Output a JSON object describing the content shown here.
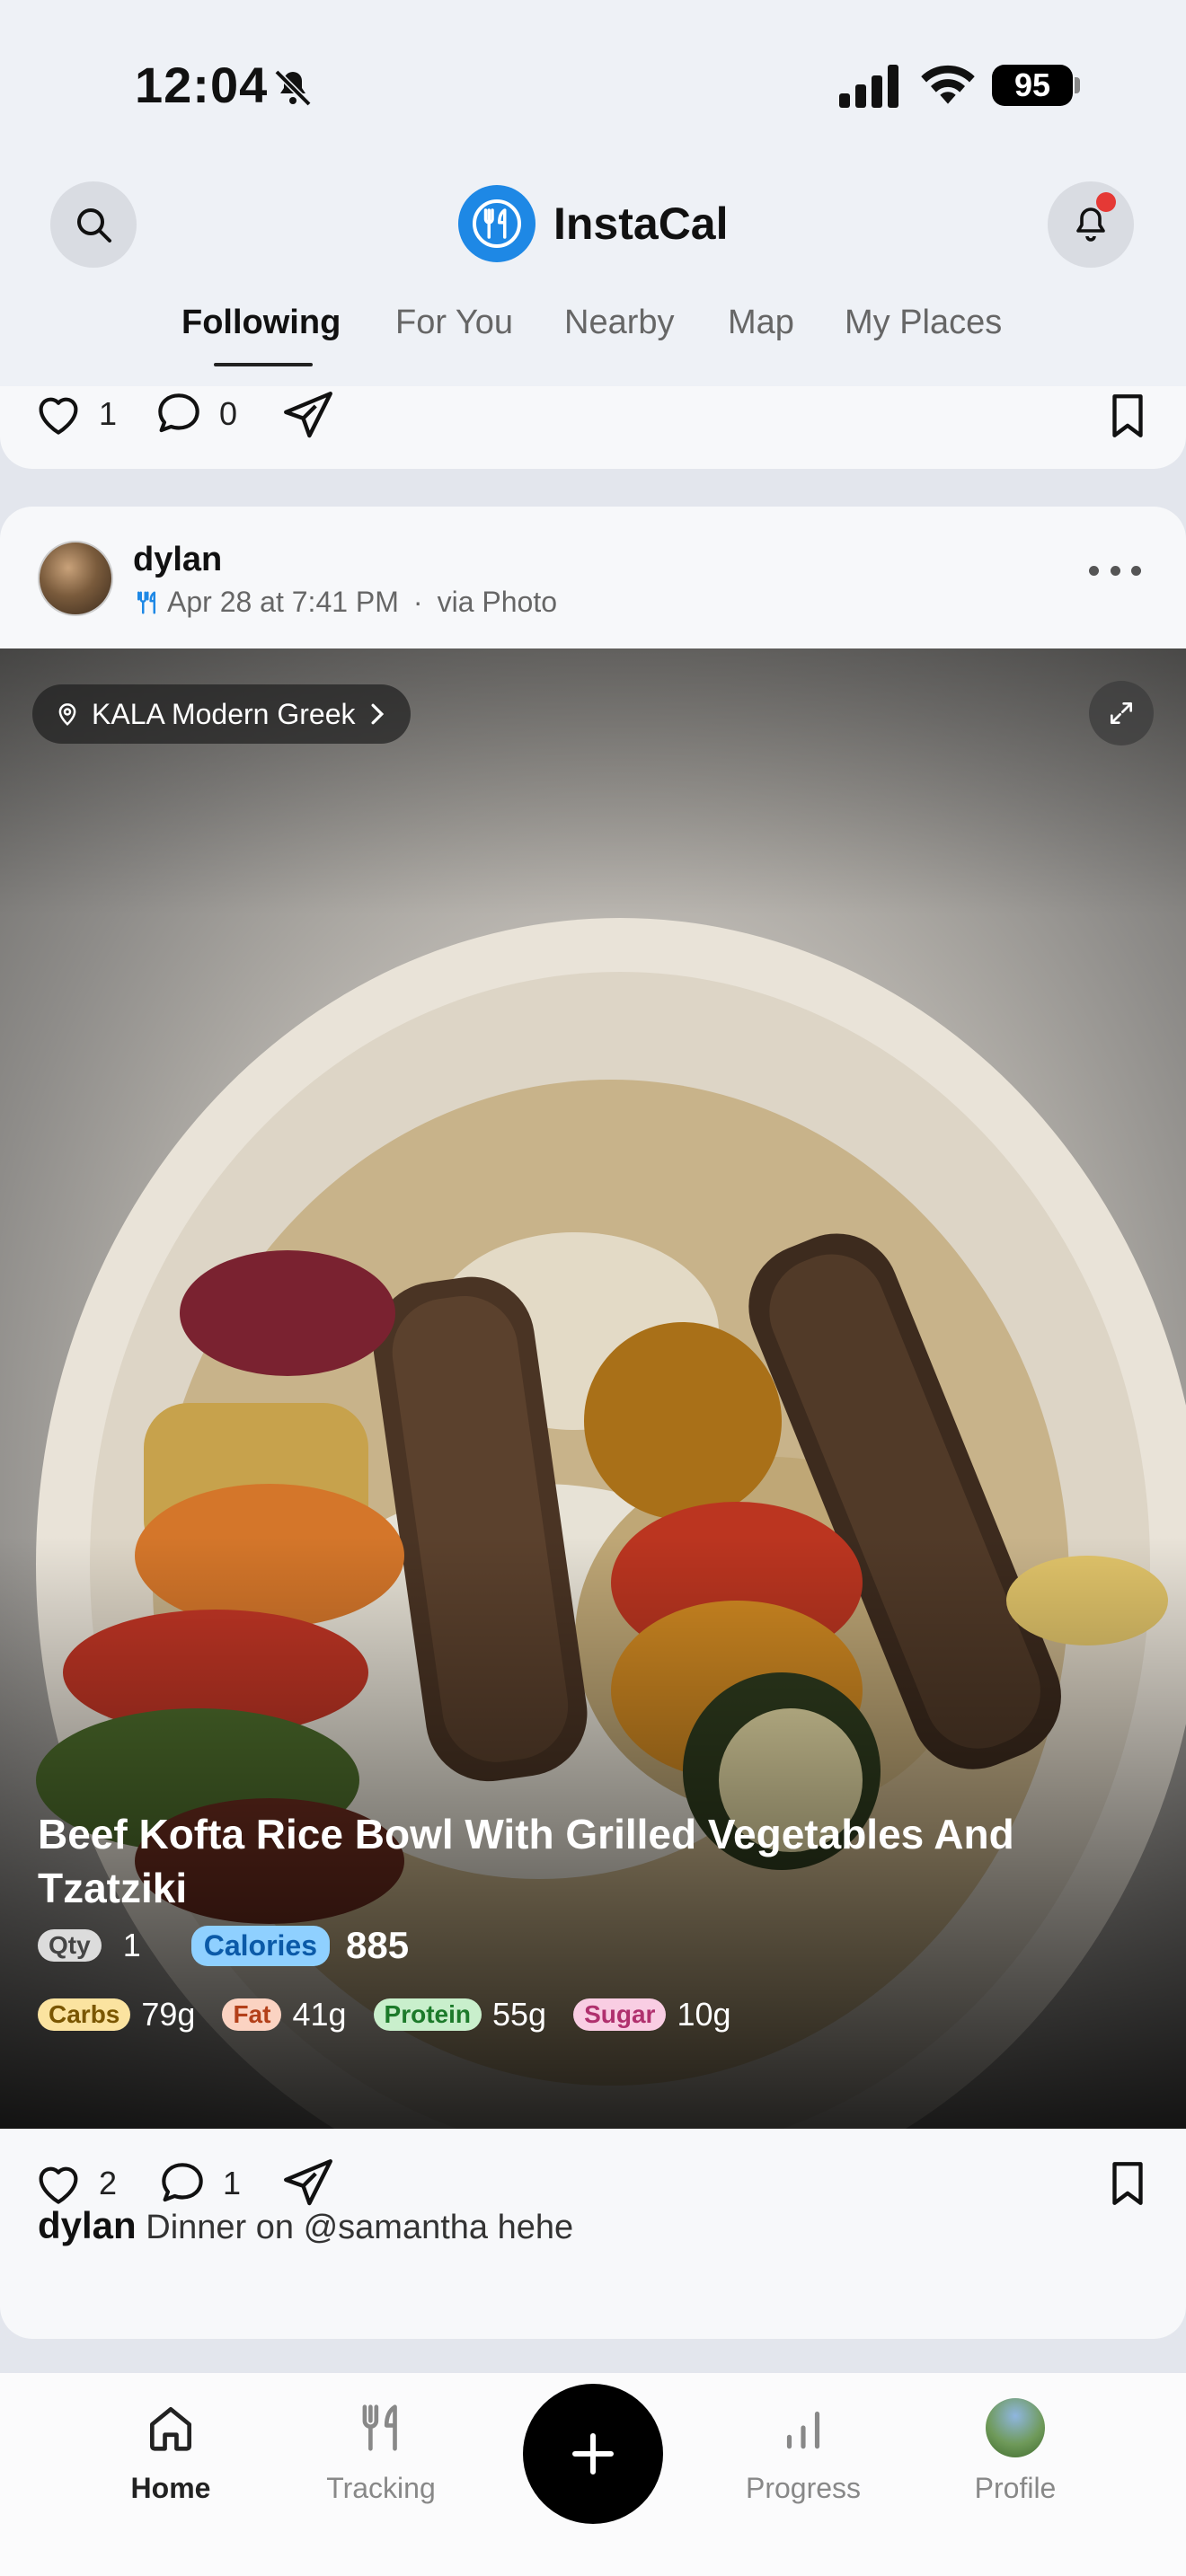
{
  "status_bar": {
    "time": "12:04",
    "battery": "95"
  },
  "header": {
    "app_name": "InstaCal",
    "tabs": [
      "Following",
      "For You",
      "Nearby",
      "Map",
      "My Places"
    ],
    "active_tab": "Following"
  },
  "previous_post": {
    "likes": "1",
    "comments": "0"
  },
  "post": {
    "username": "dylan",
    "date": "Apr 28 at 7:41 PM",
    "separator": "·",
    "source": "via Photo",
    "location": "KALA Modern Greek",
    "food_title": "Beef Kofta Rice Bowl With Grilled Vegetables And Tzatziki",
    "qty_label": "Qty",
    "qty": "1",
    "calories_label": "Calories",
    "calories": "885",
    "macros": [
      {
        "label": "Carbs",
        "value": "79g"
      },
      {
        "label": "Fat",
        "value": "41g"
      },
      {
        "label": "Protein",
        "value": "55g"
      },
      {
        "label": "Sugar",
        "value": "10g"
      }
    ],
    "likes": "2",
    "comments": "1",
    "caption_user": "dylan",
    "caption_text": "Dinner on @samantha hehe"
  },
  "bottom_nav": {
    "items": [
      {
        "label": "Home",
        "icon": "home-icon"
      },
      {
        "label": "Tracking",
        "icon": "fork-knife-icon"
      },
      {
        "label": "Progress",
        "icon": "bar-chart-icon"
      },
      {
        "label": "Profile",
        "icon": "avatar"
      }
    ],
    "active": "Home"
  },
  "colors": {
    "accent": "#1e88e5",
    "notification_dot": "#e53935",
    "fab": "#000000"
  }
}
